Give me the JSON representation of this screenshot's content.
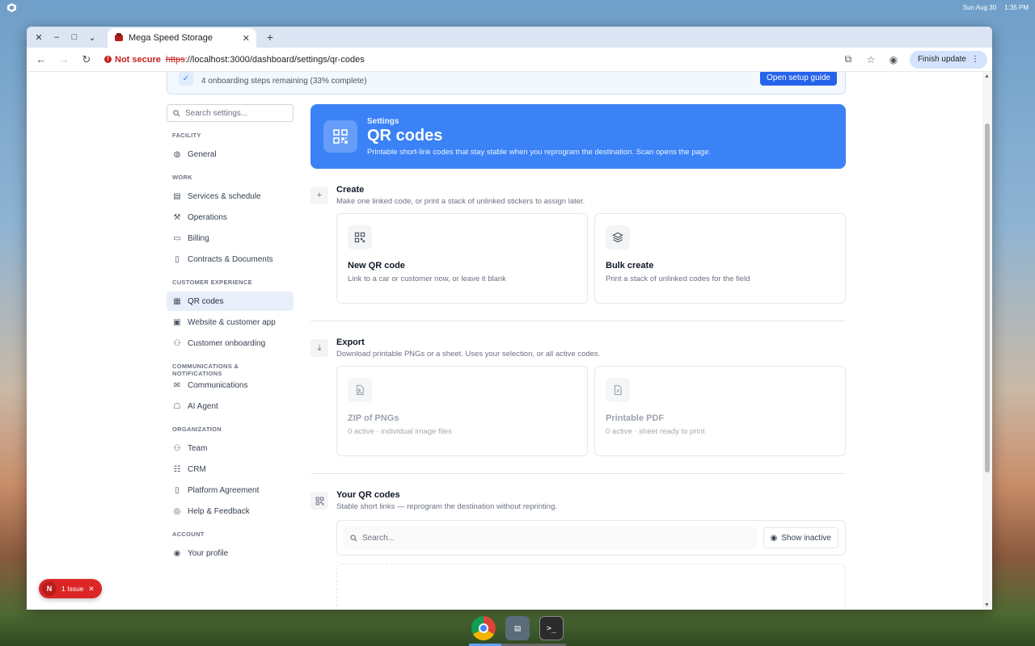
{
  "os": {
    "date": "Sun Aug 30",
    "time": "1:35 PM"
  },
  "browser": {
    "tab_title": "Mega Speed Storage",
    "not_secure": "Not secure",
    "url_scheme": "https",
    "url_rest": "://localhost:3000/dashboard/settings/qr-codes",
    "finish_update": "Finish update"
  },
  "onboarding": {
    "text": "4 onboarding steps remaining (33% complete)",
    "button": "Open setup guide"
  },
  "sidebar": {
    "search_placeholder": "Search settings...",
    "sections": {
      "facility": "FACILITY",
      "work": "WORK",
      "customer_experience": "CUSTOMER EXPERIENCE",
      "communications": "COMMUNICATIONS & NOTIFICATIONS",
      "organization": "ORGANIZATION",
      "account": "ACCOUNT"
    },
    "items": {
      "general": "General",
      "services": "Services & schedule",
      "operations": "Operations",
      "billing": "Billing",
      "contracts": "Contracts & Documents",
      "qr_codes": "QR codes",
      "website": "Website & customer app",
      "onboarding": "Customer onboarding",
      "communications": "Communications",
      "ai_agent": "AI Agent",
      "team": "Team",
      "crm": "CRM",
      "platform": "Platform Agreement",
      "help": "Help & Feedback",
      "profile": "Your profile"
    }
  },
  "hero": {
    "kicker": "Settings",
    "title": "QR codes",
    "description": "Printable short-link codes that stay stable when you reprogram the destination. Scan opens the page."
  },
  "create": {
    "title": "Create",
    "description": "Make one linked code, or print a stack of unlinked stickers to assign later.",
    "cards": [
      {
        "title": "New QR code",
        "desc": "Link to a car or customer now, or leave it blank"
      },
      {
        "title": "Bulk create",
        "desc": "Print a stack of unlinked codes for the field"
      }
    ]
  },
  "export": {
    "title": "Export",
    "description": "Download printable PNGs or a sheet. Uses your selection, or all active codes.",
    "cards": [
      {
        "title": "ZIP of PNGs",
        "desc": "0 active · individual image files"
      },
      {
        "title": "Printable PDF",
        "desc": "0 active · sheet ready to print"
      }
    ]
  },
  "your_codes": {
    "title": "Your QR codes",
    "description": "Stable short links — reprogram the destination without reprinting.",
    "search_placeholder": "Search...",
    "show_inactive": "Show inactive"
  },
  "issue_badge": {
    "letter": "N",
    "label": "1 Issue"
  }
}
